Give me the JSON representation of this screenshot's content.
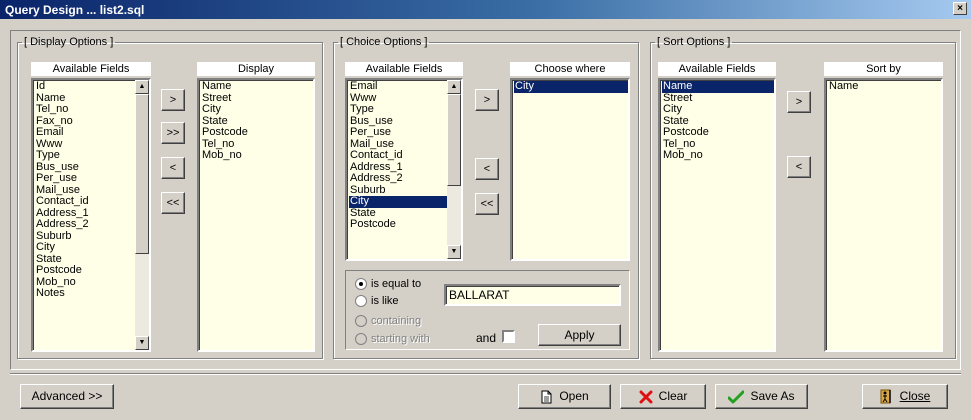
{
  "window": {
    "title": "Query Design ... list2.sql",
    "close_glyph": "×"
  },
  "display_options": {
    "legend": "[ Display Options ]",
    "available_header": "Available Fields",
    "available": [
      "Id",
      "Name",
      "Tel_no",
      "Fax_no",
      "Email",
      "Www",
      "Type",
      "Bus_use",
      "Per_use",
      "Mail_use",
      "Contact_id",
      "Address_1",
      "Address_2",
      "Suburb",
      "City",
      "State",
      "Postcode",
      "Mob_no",
      "Notes"
    ],
    "display_header": "Display",
    "display": [
      "Name",
      "Street",
      "City",
      "State",
      "Postcode",
      "Tel_no",
      "Mob_no"
    ],
    "buttons": {
      "add": ">",
      "add_all": ">>",
      "remove": "<",
      "remove_all": "<<"
    }
  },
  "choice_options": {
    "legend": "[ Choice Options ]",
    "available_header": "Available Fields",
    "available": [
      "Email",
      "Www",
      "Type",
      "Bus_use",
      "Per_use",
      "Mail_use",
      "Contact_id",
      "Address_1",
      "Address_2",
      "Suburb",
      "City",
      "State",
      "Postcode"
    ],
    "selected_available": "City",
    "choose_header": "Choose where",
    "choose": [
      "City"
    ],
    "selected_choose": "City",
    "buttons": {
      "add": ">",
      "remove": "<",
      "remove_all": "<<"
    },
    "conditions": {
      "is_equal_to": "is equal to",
      "is_like": "is like",
      "containing": "containing",
      "starting_with": "starting with",
      "selected": "is equal to"
    },
    "value": "BALLARAT",
    "and_label": "and",
    "and_checked": false,
    "apply_label": "Apply"
  },
  "sort_options": {
    "legend": "[ Sort Options ]",
    "available_header": "Available Fields",
    "available": [
      "Name",
      "Street",
      "City",
      "State",
      "Postcode",
      "Tel_no",
      "Mob_no"
    ],
    "selected_available": "Name",
    "sortby_header": "Sort by",
    "sortby": [
      "Name"
    ],
    "buttons": {
      "add": ">",
      "remove": "<"
    }
  },
  "footer": {
    "advanced_label": "Advanced >>",
    "open_label": "Open",
    "clear_label": "Clear",
    "save_as_label": "Save As",
    "close_label": "Close",
    "colors": {
      "clear_icon": "#e01010",
      "save_icon": "#22a020",
      "close_icon": "#c08000"
    }
  }
}
